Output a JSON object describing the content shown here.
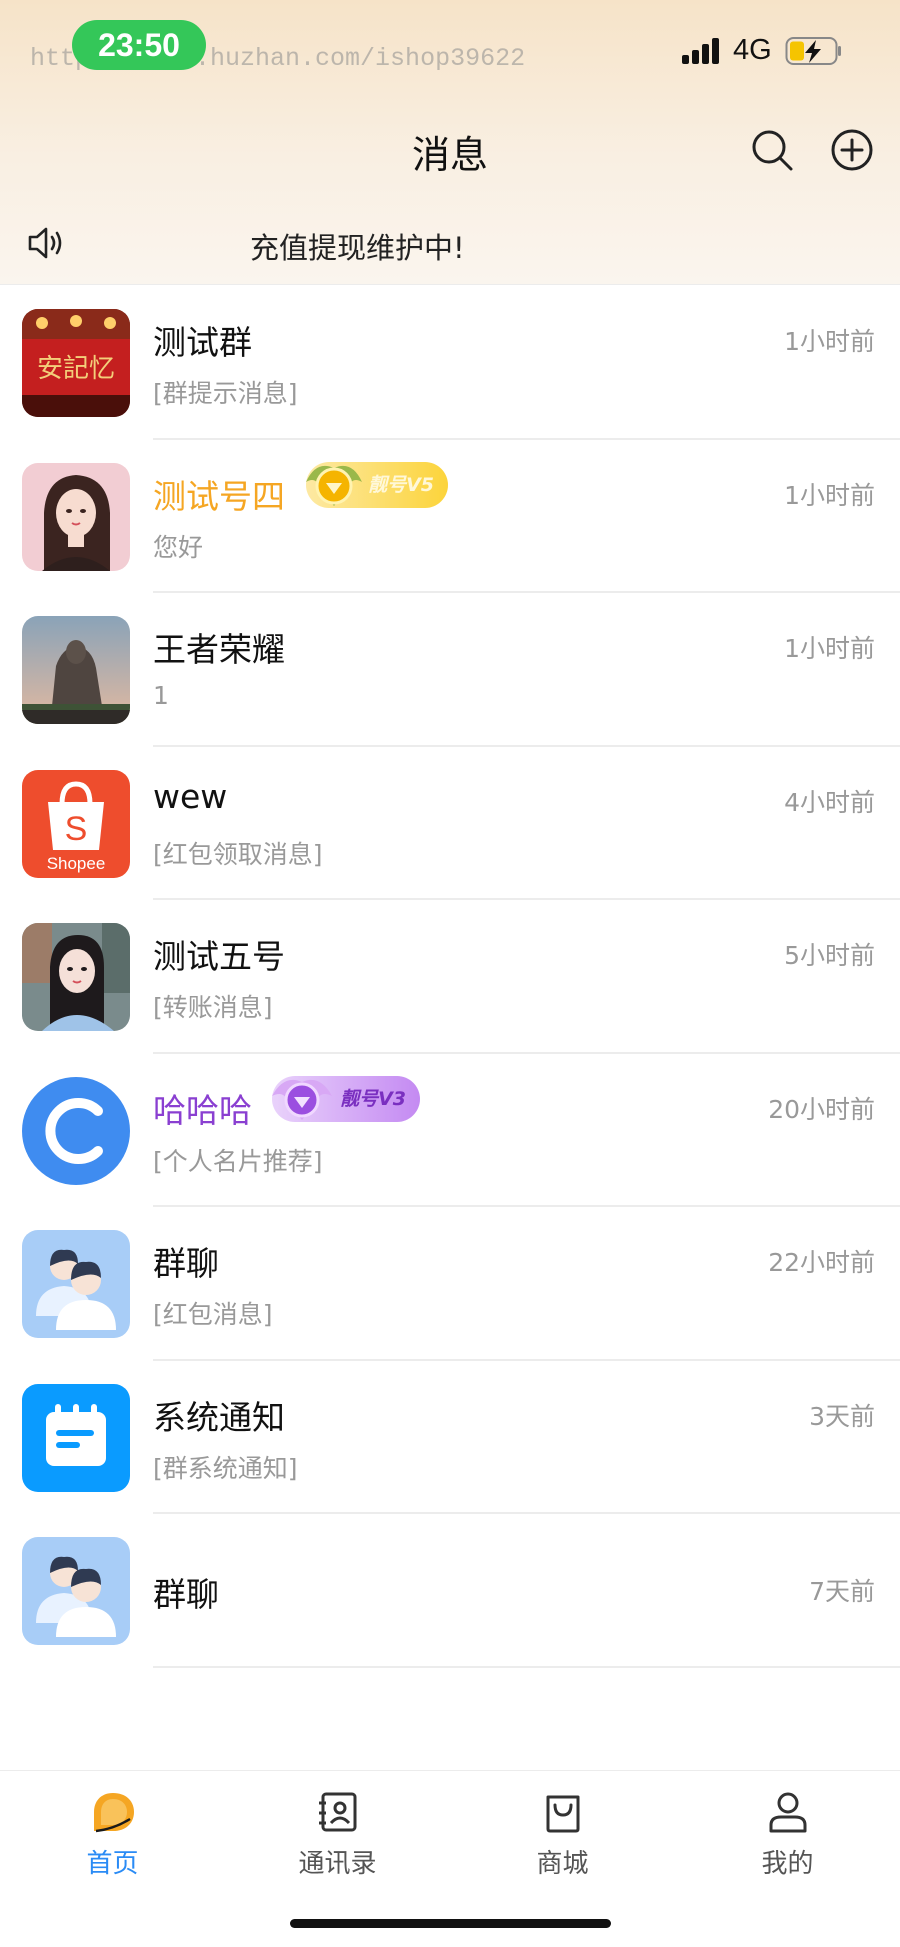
{
  "status_bar": {
    "time": "23:50",
    "watermark": "https://www.huzhan.com/ishop39622",
    "network": "4G"
  },
  "header": {
    "title": "消息",
    "search_icon": "search-icon",
    "add_icon": "plus-circle-icon"
  },
  "notice": {
    "icon": "speaker-icon",
    "text": "充值提现维护中!"
  },
  "chats": [
    {
      "name": "测试群",
      "preview": "[群提示消息]",
      "time": "1小时前",
      "name_color": "#111111"
    },
    {
      "name": "测试号四",
      "preview": "您好",
      "time": "1小时前",
      "name_color": "#f5a623",
      "badge": "靓号V5"
    },
    {
      "name": "王者荣耀",
      "preview": "1",
      "time": "1小时前",
      "name_color": "#111111"
    },
    {
      "name": "wew",
      "preview": "[红包领取消息]",
      "time": "4小时前",
      "name_color": "#111111",
      "avatar_text": "Shopee"
    },
    {
      "name": "测试五号",
      "preview": "[转账消息]",
      "time": "5小时前",
      "name_color": "#111111"
    },
    {
      "name": "哈哈哈",
      "preview": "[个人名片推荐]",
      "time": "20小时前",
      "name_color": "#8a3fd1",
      "badge": "靓号V3"
    },
    {
      "name": "群聊",
      "preview": "[红包消息]",
      "time": "22小时前",
      "name_color": "#111111"
    },
    {
      "name": "系统通知",
      "preview": "[群系统通知]",
      "time": "3天前",
      "name_color": "#111111"
    },
    {
      "name": "群聊",
      "preview": "",
      "time": "7天前",
      "name_color": "#111111"
    }
  ],
  "tabs": [
    {
      "label": "首页",
      "icon": "chat-bubble-icon",
      "active": true
    },
    {
      "label": "通讯录",
      "icon": "contacts-book-icon",
      "active": false
    },
    {
      "label": "商城",
      "icon": "shopping-bag-icon",
      "active": false
    },
    {
      "label": "我的",
      "icon": "person-icon",
      "active": false
    }
  ],
  "colors": {
    "accent": "#2a8bf5",
    "tab_active_icon": "#f5a623",
    "status_pill": "#34c759",
    "vip_gold": "#f5a623",
    "vip_purple": "#8a3fd1"
  }
}
